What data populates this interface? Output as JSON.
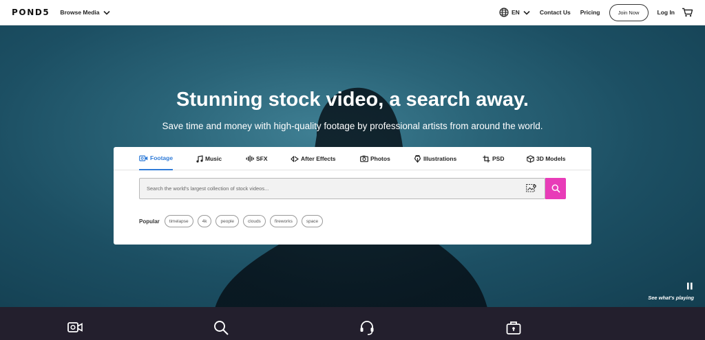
{
  "nav": {
    "logo": "POND5",
    "browse_label": "Browse Media",
    "language": "EN",
    "contact": "Contact Us",
    "pricing": "Pricing",
    "join": "Join Now",
    "login": "Log In"
  },
  "hero": {
    "title": "Stunning stock video, a search away.",
    "subtitle": "Save time and money with high-quality footage by professional artists from around the world."
  },
  "search": {
    "tabs": [
      {
        "label": "Footage",
        "icon": "video-camera-icon",
        "active": true
      },
      {
        "label": "Music",
        "icon": "music-note-icon",
        "active": false
      },
      {
        "label": "SFX",
        "icon": "sound-wave-icon",
        "active": false
      },
      {
        "label": "After Effects",
        "icon": "after-effects-icon",
        "active": false
      },
      {
        "label": "Photos",
        "icon": "camera-icon",
        "active": false
      },
      {
        "label": "Illustrations",
        "icon": "pen-nib-icon",
        "active": false
      },
      {
        "label": "PSD",
        "icon": "crop-icon",
        "active": false
      },
      {
        "label": "3D Models",
        "icon": "cube-icon",
        "active": false
      }
    ],
    "placeholder": "Search the world's largest collection of stock videos...",
    "button_color": "#e83cb8",
    "active_tab_color": "#2f7bd8"
  },
  "popular": {
    "label": "Popular",
    "tags": [
      "timelapse",
      "4k",
      "people",
      "clouds",
      "fireworks",
      "space"
    ]
  },
  "player": {
    "see_playing": "See what's playing"
  },
  "strip": {
    "icons": [
      "video-camera-icon",
      "search-icon",
      "support-headset-icon",
      "briefcase-lock-icon"
    ]
  }
}
